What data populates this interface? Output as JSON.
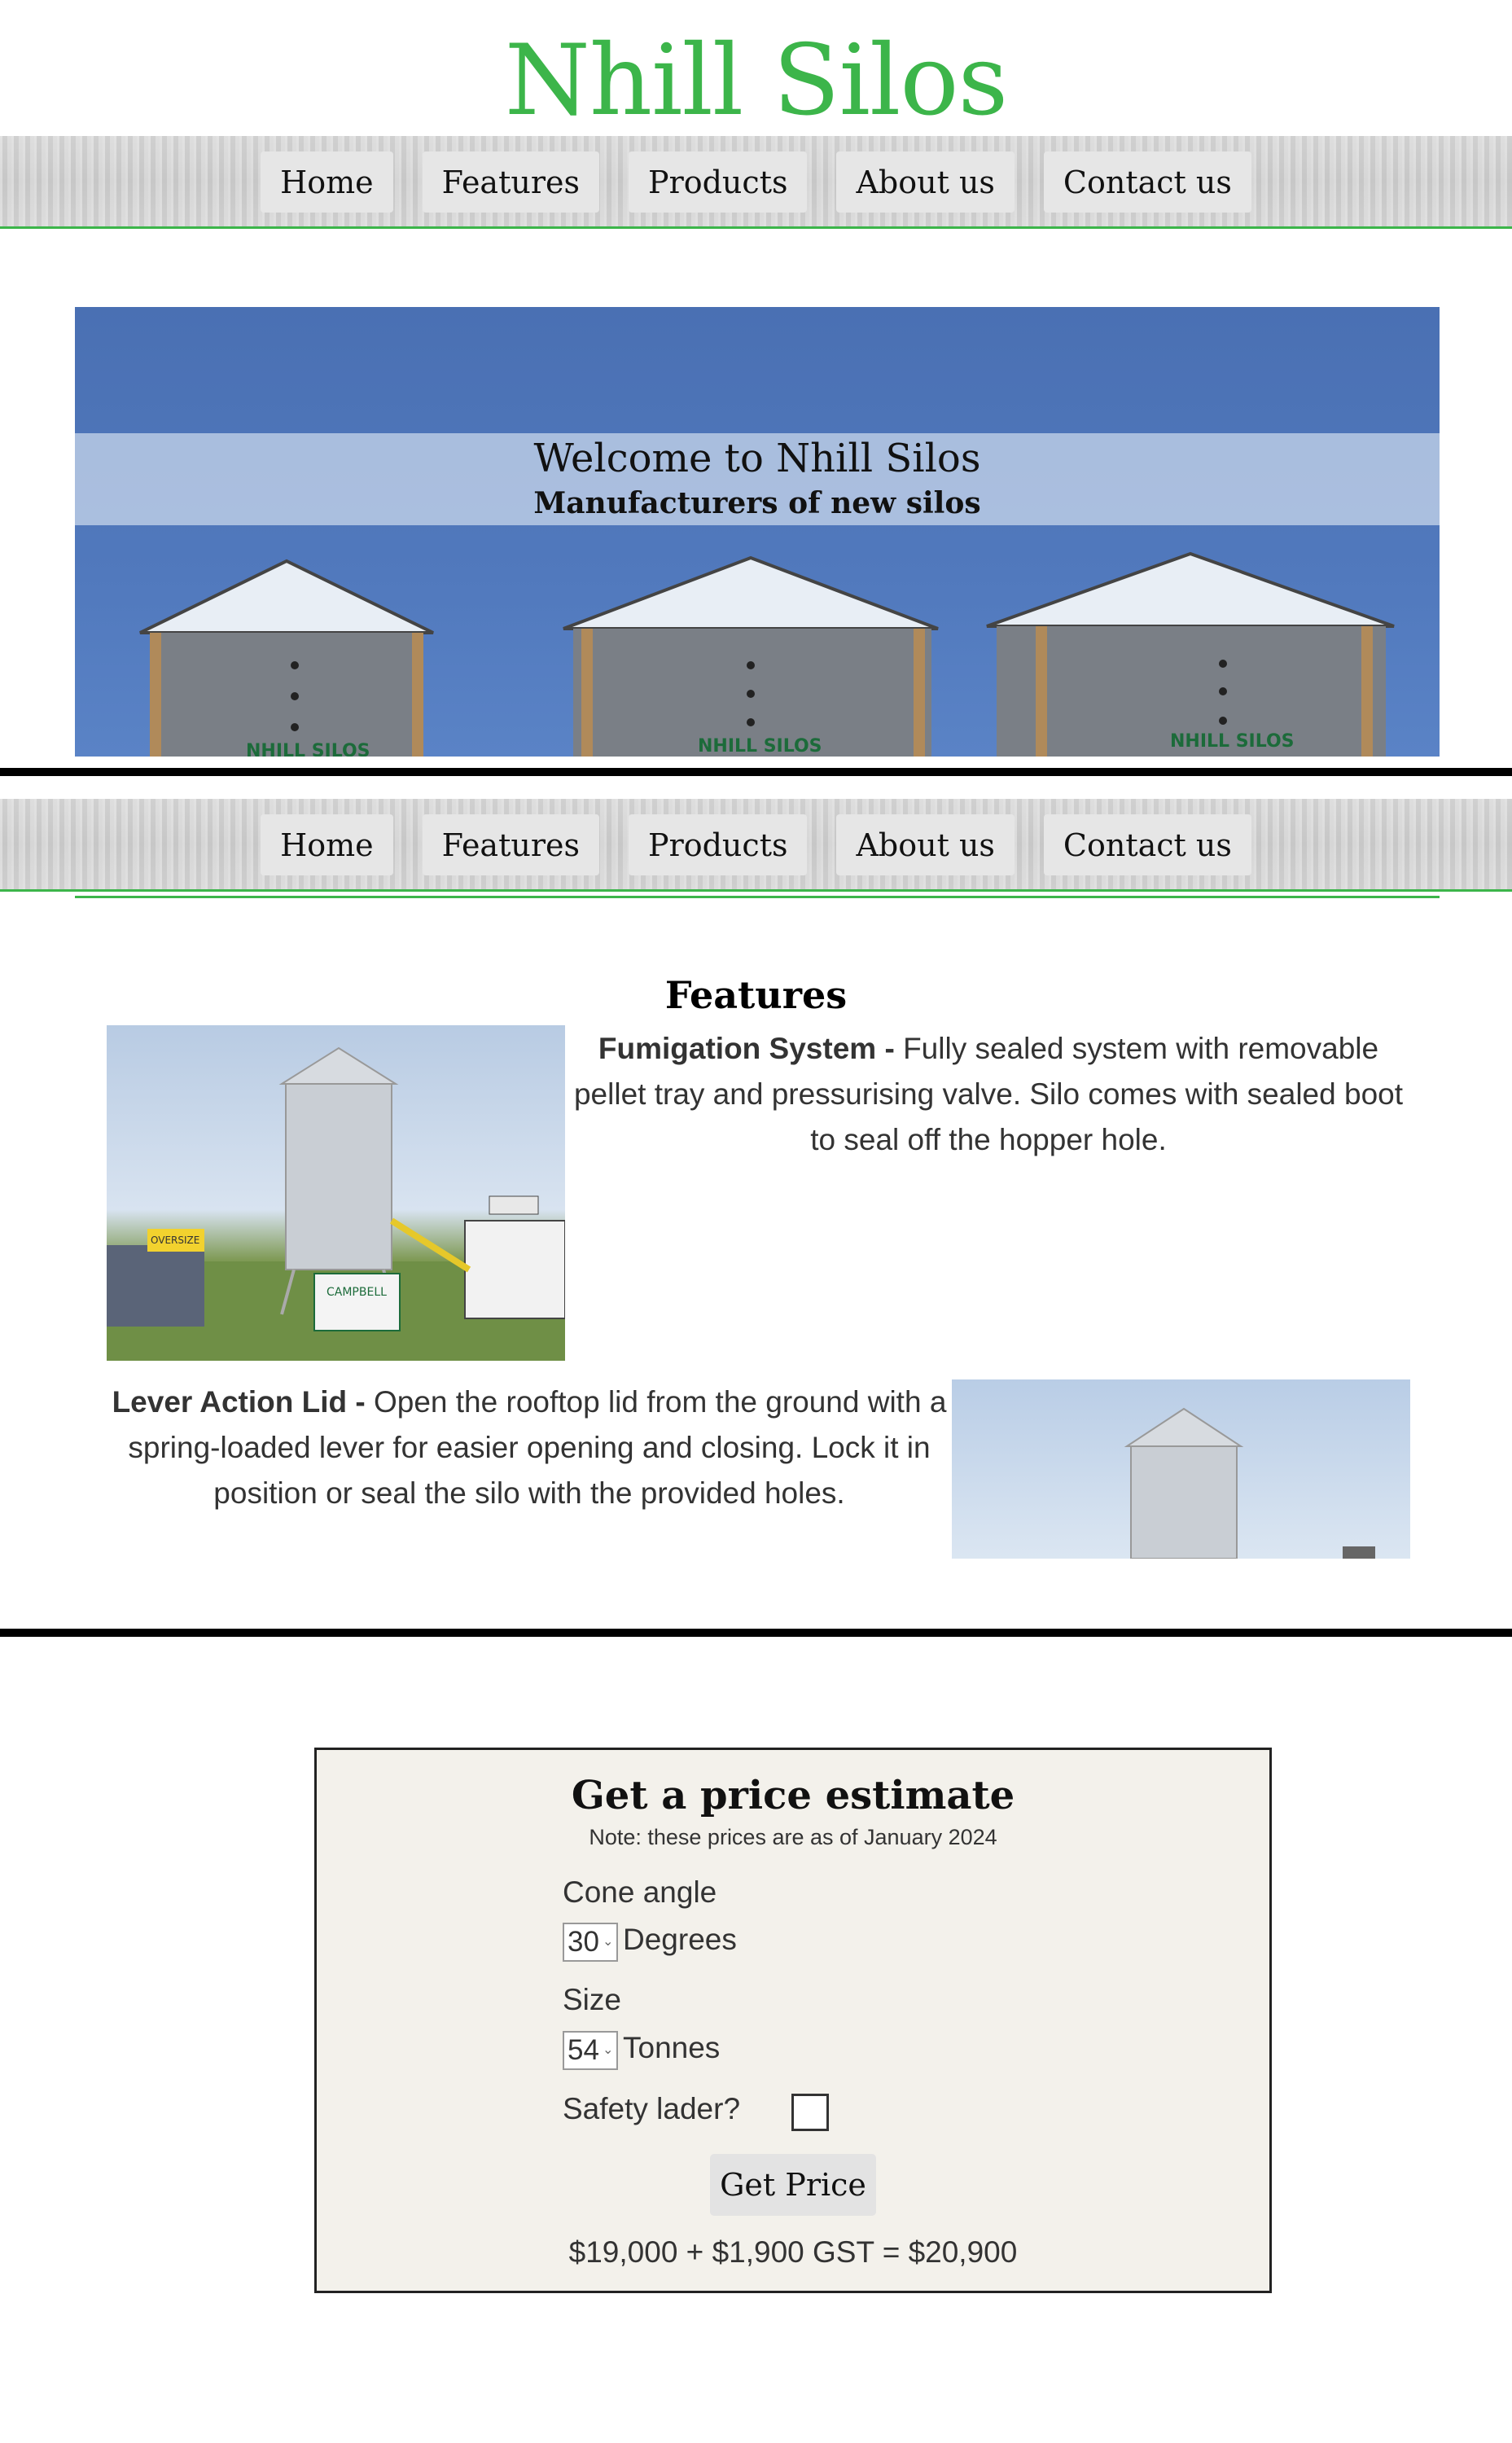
{
  "site": {
    "title": "Nhill Silos"
  },
  "nav": {
    "items": [
      "Home",
      "Features",
      "Products",
      "About us",
      "Contact us"
    ]
  },
  "hero": {
    "welcome": "Welcome to Nhill Silos",
    "subtitle": "Manufacturers of new silos",
    "silo_brand": "NHILL SILOS"
  },
  "features": {
    "title": "Features",
    "items": [
      {
        "name": "Fumigation System",
        "separator": " - ",
        "text": "Fully sealed system with removable pellet tray and pressurising valve. Silo comes with sealed boot to seal off the hopper hole."
      },
      {
        "name": "Lever Action Lid",
        "separator": " - ",
        "text": "Open the rooftop lid from the ground with a spring-loaded lever for easier opening and closing. Lock it in position or seal the silo with the provided holes."
      }
    ],
    "image_text": {
      "oversize": "OVERSIZE",
      "campbell": "CAMPBELL",
      "brand": "NHILL SILOS"
    }
  },
  "estimate": {
    "title": "Get a price estimate",
    "note": "Note: these prices are as of January 2024",
    "cone_label": "Cone angle",
    "cone_value": "30",
    "cone_unit": "Degrees",
    "size_label": "Size",
    "size_value": "54",
    "size_unit": "Tonnes",
    "ladder_label": "Safety lader?",
    "ladder_checked": false,
    "button": "Get Price",
    "result": "$19,000 + $1,900 GST = $20,900"
  },
  "colors": {
    "brand_green": "#3cb54a",
    "sky_blue": "#4a70b3"
  }
}
